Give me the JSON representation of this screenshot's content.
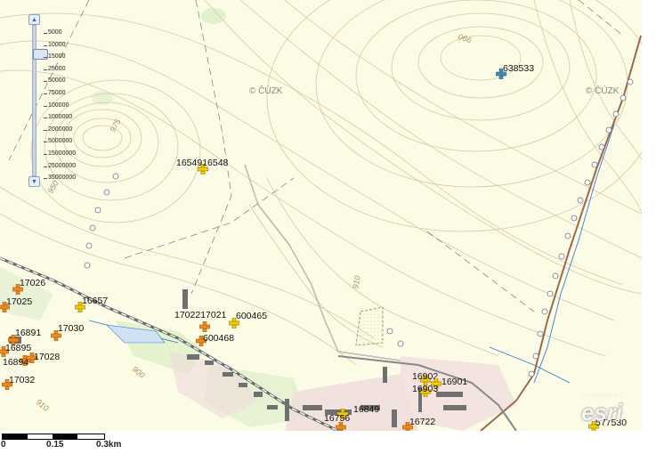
{
  "map": {
    "watermarks": [
      "© ČÚZK",
      "© ČÚZK"
    ],
    "contour_labels": [
      "990",
      "975",
      "950",
      "910",
      "900",
      "910"
    ],
    "markers": [
      {
        "id": "m638533",
        "label": "638533",
        "kind": "blue-cross"
      },
      {
        "id": "m16549",
        "label": "1654916548",
        "kind": "yellow-cross"
      },
      {
        "id": "m17026",
        "label": "17026",
        "kind": "orange-cross"
      },
      {
        "id": "m17025",
        "label": "17025",
        "kind": "orange-cross"
      },
      {
        "id": "m16657",
        "label": "16657",
        "kind": "yellow-cross"
      },
      {
        "id": "m17030",
        "label": "17030",
        "kind": "orange-cross"
      },
      {
        "id": "m16891",
        "label": "16891",
        "kind": "orange-cross"
      },
      {
        "id": "m16895",
        "label": "16895",
        "kind": "orange-cross"
      },
      {
        "id": "m16894",
        "label": "16894",
        "kind": "orange-cross"
      },
      {
        "id": "m17028",
        "label": "17028",
        "kind": "orange-cross"
      },
      {
        "id": "m17032",
        "label": "17032",
        "kind": "orange-cross"
      },
      {
        "id": "m17022",
        "label": "1702217021",
        "kind": "orange-cross"
      },
      {
        "id": "m600465",
        "label": "600465",
        "kind": "yellow-cross"
      },
      {
        "id": "m600468",
        "label": "600468",
        "kind": "orange-cross"
      },
      {
        "id": "m16902",
        "label": "16902",
        "kind": "yellow-cross"
      },
      {
        "id": "m16901",
        "label": "16901",
        "kind": "yellow-cross"
      },
      {
        "id": "m16903",
        "label": "16903",
        "kind": "yellow-cross"
      },
      {
        "id": "m16849",
        "label": "16849",
        "kind": "yellow-cross"
      },
      {
        "id": "m16756",
        "label": "16756",
        "kind": "orange-cross"
      },
      {
        "id": "m16722",
        "label": "16722",
        "kind": "orange-cross"
      },
      {
        "id": "m577530",
        "label": "577530",
        "kind": "yellow-cross"
      }
    ]
  },
  "zoom": {
    "ticks": [
      "5000",
      "10000",
      "15000",
      "25000",
      "50000",
      "75000",
      "100000",
      "1000000",
      "2000000",
      "5000000",
      "15000000",
      "25000000",
      "35000000"
    ],
    "up_icon": "▲",
    "down_icon": "▼"
  },
  "scale": {
    "labels": [
      "0",
      "0.15",
      "0.3km"
    ]
  },
  "logo": {
    "powered_by": "POWERED BY",
    "name": "esri"
  },
  "colors": {
    "marker_yellow": "#f0d000",
    "marker_orange": "#f08a20",
    "marker_blue": "#2a8fe0",
    "road": "#b04040",
    "stream": "#3a7ad0"
  }
}
